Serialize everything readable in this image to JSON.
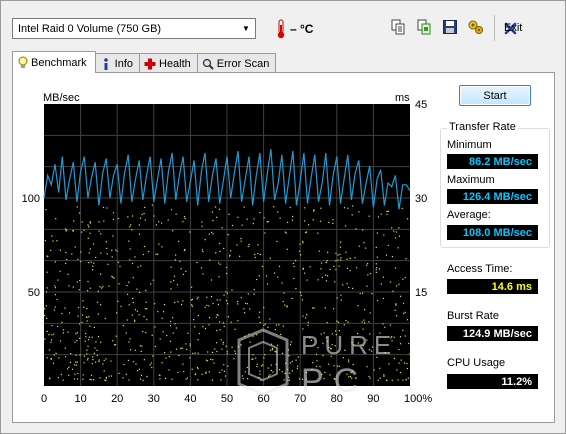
{
  "toolbar": {
    "drive": "Intel   Raid 0 Volume (750 GB)",
    "temperature": "– °C",
    "buttons": [
      "copy-info-icon",
      "copy-screenshot-icon",
      "save-icon",
      "options-icon"
    ],
    "exit_label": "Exit"
  },
  "tabs": [
    {
      "label": "Benchmark",
      "icon": "lightbulb-icon",
      "active": true
    },
    {
      "label": "Info",
      "icon": "info-icon",
      "active": false
    },
    {
      "label": "Health",
      "icon": "cross-icon",
      "active": false
    },
    {
      "label": "Error Scan",
      "icon": "magnifier-icon",
      "active": false
    }
  ],
  "benchmark": {
    "start_label": "Start",
    "transfer_rate": {
      "title": "Transfer Rate",
      "minimum_label": "Minimum",
      "minimum": "86.2 MB/sec",
      "maximum_label": "Maximum",
      "maximum": "126.4 MB/sec",
      "average_label": "Average:",
      "average": "108.0 MB/sec"
    },
    "access_time_label": "Access Time:",
    "access_time": "14.6 ms",
    "burst_rate_label": "Burst Rate",
    "burst_rate": "124.9 MB/sec",
    "cpu_usage_label": "CPU Usage",
    "cpu_usage": "11.2%"
  },
  "watermark": {
    "line1": "PURE",
    "line2": "PC"
  },
  "chart_data": {
    "type": "line",
    "xlabel": "",
    "ylabel_left": "MB/sec",
    "ylabel_right": "ms",
    "x_ticks": [
      "0",
      "10",
      "20",
      "30",
      "40",
      "50",
      "60",
      "70",
      "80",
      "90",
      "100%"
    ],
    "y_left_ticks": [
      "50",
      "100"
    ],
    "y_right_ticks": [
      "15",
      "30",
      "45"
    ],
    "y_left_range": [
      0,
      150
    ],
    "y_right_range": [
      0,
      45
    ],
    "x_range": [
      0,
      100
    ],
    "grid": true,
    "colors": {
      "background": "#000000",
      "grid": "#404040",
      "transfer": "#1e9bd7",
      "access": "#e6e62a"
    },
    "series": [
      {
        "type": "line",
        "axis": "left",
        "x": [
          0,
          1,
          2,
          3,
          4,
          5,
          6,
          7,
          8,
          9,
          10,
          11,
          12,
          13,
          14,
          15,
          16,
          17,
          18,
          19,
          20,
          21,
          22,
          23,
          24,
          25,
          26,
          27,
          28,
          29,
          30,
          31,
          32,
          33,
          34,
          35,
          36,
          37,
          38,
          39,
          40,
          41,
          42,
          43,
          44,
          45,
          46,
          47,
          48,
          49,
          50,
          51,
          52,
          53,
          54,
          55,
          56,
          57,
          58,
          59,
          60,
          61,
          62,
          63,
          64,
          65,
          66,
          67,
          68,
          69,
          70,
          71,
          72,
          73,
          74,
          75,
          76,
          77,
          78,
          79,
          80,
          81,
          82,
          83,
          84,
          85,
          86,
          87,
          88,
          89,
          90,
          91,
          92,
          93,
          94,
          95,
          96,
          97,
          98,
          99,
          100
        ],
        "values": [
          100,
          112,
          107,
          118,
          103,
          122,
          99,
          110,
          119,
          98,
          114,
          122,
          100,
          111,
          119,
          96,
          113,
          121,
          100,
          112,
          118,
          97,
          113,
          123,
          98,
          110,
          120,
          99,
          112,
          122,
          98,
          110,
          121,
          97,
          114,
          124,
          99,
          112,
          122,
          98,
          109,
          120,
          96,
          114,
          124,
          98,
          112,
          121,
          97,
          109,
          122,
          100,
          113,
          125,
          98,
          110,
          122,
          96,
          112,
          124,
          98,
          113,
          126,
          99,
          108,
          123,
          97,
          111,
          125,
          96,
          109,
          124,
          97,
          111,
          123,
          98,
          108,
          124,
          96,
          112,
          122,
          97,
          110,
          123,
          99,
          113,
          120,
          97,
          108,
          117,
          95,
          110,
          115,
          96,
          108,
          106,
          112,
          94,
          107,
          107,
          104
        ]
      },
      {
        "type": "scatter",
        "axis": "right",
        "name": "",
        "range_ms": [
          1,
          29
        ]
      }
    ]
  }
}
